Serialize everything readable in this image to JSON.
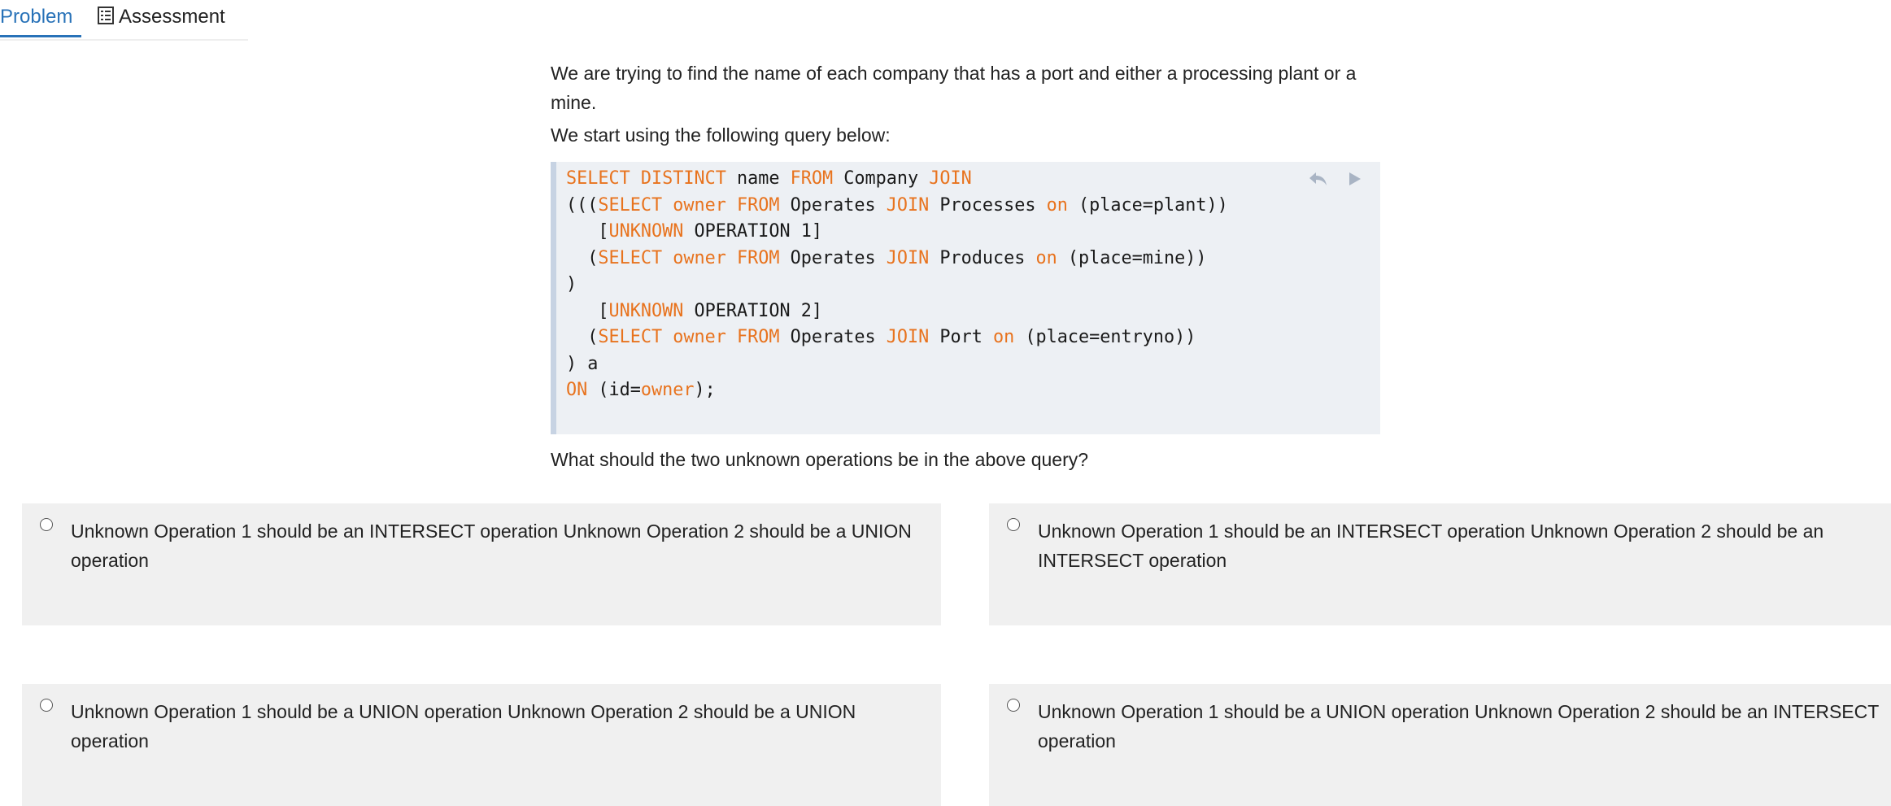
{
  "tabs": {
    "problem": "Problem",
    "assessment": "Assessment"
  },
  "prompt": {
    "intro": "We are trying to find the name of each company that has a port and either a processing plant or a mine.",
    "start": "We start using the following query below:",
    "question": "What should the two unknown operations be in the above query?"
  },
  "code_lines": [
    "SELECT DISTINCT name FROM Company JOIN",
    "(((SELECT owner FROM Operates JOIN Processes on (place=plant))",
    "   [UNKNOWN OPERATION 1]",
    "  (SELECT owner FROM Operates JOIN Produces on (place=mine))",
    ")",
    "   [UNKNOWN OPERATION 2]",
    "  (SELECT owner FROM Operates JOIN Port on (place=entryno))",
    ") a",
    "ON (id=owner);"
  ],
  "keywords": [
    "SELECT",
    "DISTINCT",
    "FROM",
    "JOIN",
    "owner",
    "on",
    "UNKNOWN",
    "ON"
  ],
  "options": [
    "Unknown Operation 1 should be an INTERSECT operation Unknown Operation 2 should be a UNION operation",
    "Unknown Operation 1 should be an INTERSECT operation Unknown Operation 2 should be an INTERSECT operation",
    "Unknown Operation 1 should be a UNION operation Unknown Operation 2 should be a UNION operation",
    "Unknown Operation 1 should be a UNION operation Unknown Operation 2 should be an INTERSECT operation"
  ],
  "colors": {
    "tab_active": "#2872b8",
    "keyword": "#e8731e",
    "code_bg": "#edf0f4",
    "option_bg": "#f0f0f0"
  },
  "icons": {
    "assessment": "assessment-list-icon",
    "reset": "undo-icon",
    "run": "play-icon"
  }
}
